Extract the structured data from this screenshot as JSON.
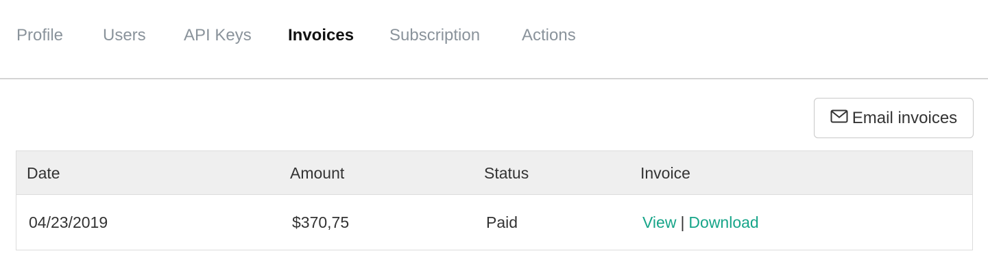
{
  "tabs": [
    {
      "label": "Profile"
    },
    {
      "label": "Users"
    },
    {
      "label": "API Keys"
    },
    {
      "label": "Invoices",
      "active": true
    },
    {
      "label": "Subscription"
    },
    {
      "label": "Actions"
    }
  ],
  "toolbar": {
    "email_label": "Email invoices",
    "email_icon": "envelope-icon"
  },
  "table": {
    "headers": [
      "Date",
      "Amount",
      "Status",
      "Invoice"
    ],
    "rows": [
      {
        "date": "04/23/2019",
        "amount": "$370,75",
        "status": "Paid",
        "view_label": "View",
        "separator": "|",
        "download_label": "Download"
      }
    ]
  },
  "colors": {
    "link": "#17a589",
    "active_tab": "#111111",
    "inactive_tab": "#8a939b",
    "header_bg": "#efefef"
  }
}
